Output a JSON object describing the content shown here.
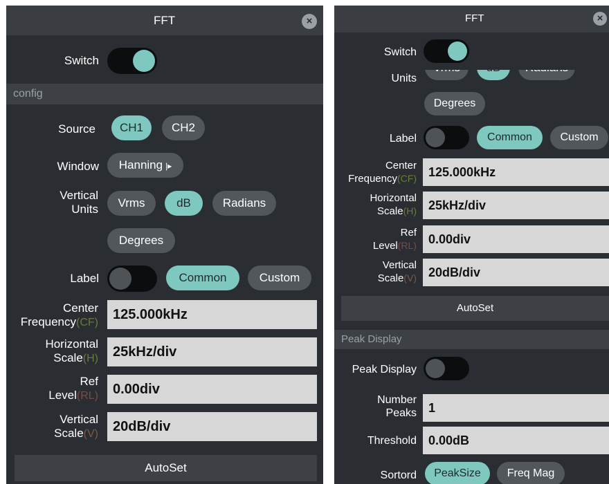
{
  "title": "FFT",
  "close_glyph": "×",
  "switch_label": "Switch",
  "section_config": "config",
  "source": {
    "label": "Source",
    "options": [
      "CH1",
      "CH2"
    ],
    "selected": "CH1"
  },
  "window": {
    "label": "Window",
    "value": "Hanning"
  },
  "vertical_units": {
    "label_line1": "Vertical",
    "label_line2": "Units",
    "options": [
      "Vrms",
      "dB",
      "Radians",
      "Degrees"
    ],
    "selected": "dB"
  },
  "label_row": {
    "label": "Label",
    "options": [
      "Common",
      "Custom"
    ],
    "selected": "Common"
  },
  "center_frequency": {
    "line1": "Center",
    "line2": "Frequency",
    "suffix": "(CF)",
    "value": "125.000kHz"
  },
  "horizontal_scale": {
    "line1": "Horizontal",
    "line2": "Scale",
    "suffix": "(H)",
    "value": "25kHz/div"
  },
  "ref_level": {
    "line1": "Ref",
    "line2": "Level",
    "suffix": "(RL)",
    "value": "0.00div"
  },
  "vertical_scale": {
    "line1": "Vertical",
    "line2": "Scale",
    "suffix": "(V)",
    "value": "20dB/div"
  },
  "autoset": "AutoSet",
  "section_peak": "Peak Display",
  "peak_display_label": "Peak Display",
  "number_peaks": {
    "line1": "Number",
    "line2": "Peaks",
    "value": "1"
  },
  "threshold": {
    "label": "Threshold",
    "value": "0.00dB"
  },
  "sortord": {
    "label": "Sortord",
    "options": [
      "PeakSize",
      "Freq Mag"
    ],
    "selected": "PeakSize"
  },
  "right_partial": {
    "units_label": "Units",
    "options_cut": [
      "Vrms",
      "dB",
      "Radians"
    ]
  },
  "colors": {
    "accent": "#7ec8c0",
    "panel": "#2a2e33",
    "field": "#d7d7d7"
  }
}
